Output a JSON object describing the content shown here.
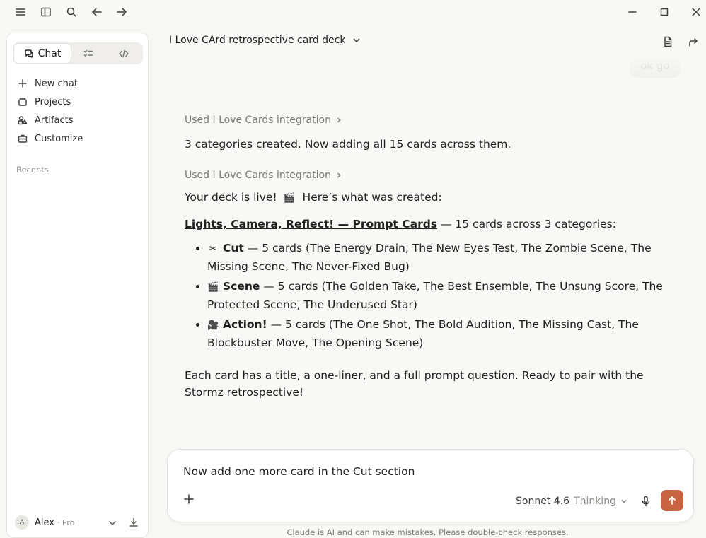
{
  "sidebar": {
    "modes": [
      {
        "label": "Chat",
        "icon": "chat-icon",
        "active": true
      },
      {
        "label": "",
        "icon": "tasks-icon",
        "active": false
      },
      {
        "label": "",
        "icon": "code-icon",
        "active": false
      }
    ],
    "nav": [
      {
        "label": "New chat",
        "icon": "plus-icon"
      },
      {
        "label": "Projects",
        "icon": "folder-icon"
      },
      {
        "label": "Artifacts",
        "icon": "artifacts-icon"
      },
      {
        "label": "Customize",
        "icon": "briefcase-icon"
      }
    ],
    "recents_label": "Recents",
    "user": {
      "initial": "A",
      "name": "Alex",
      "plan": "· Pro"
    }
  },
  "header": {
    "title": "I Love CArd retrospective card deck"
  },
  "conversation": {
    "user_message": "ok go",
    "tool_call_1": "Used I Love Cards integration",
    "text_1": "3 categories created. Now adding all 15 cards across them.",
    "tool_call_2": "Used I Love Cards integration",
    "text_2_prefix": "Your deck is live!",
    "text_2_emoji": "🎬",
    "text_2_suffix": "Here’s what was created:",
    "deck_title": "Lights, Camera, Reflect! — Prompt Cards",
    "deck_summary": "— 15 cards across 3 categories:",
    "categories": [
      {
        "emoji": "✂",
        "name": "Cut",
        "desc": "— 5 cards (The Energy Drain, The New Eyes Test, The Zombie Scene, The Missing Scene, The Never-Fixed Bug)"
      },
      {
        "emoji": "🎬",
        "name": "Scene",
        "desc": "— 5 cards (The Golden Take, The Best Ensemble, The Unsung Score, The Protected Scene, The Underused Star)"
      },
      {
        "emoji": "🎥",
        "name": "Action!",
        "desc": "— 5 cards (The One Shot, The Bold Audition, The Missing Cast, The Blockbuster Move, The Opening Scene)"
      }
    ],
    "closing": "Each card has a title, a one-liner, and a full prompt question. Ready to pair with the Stormz retrospective!"
  },
  "composer": {
    "text": "Now add one more card in the Cut section",
    "model": "Sonnet 4.6",
    "mode": "Thinking"
  },
  "disclaimer": "Claude is AI and can make mistakes. Please double-check responses.",
  "colors": {
    "accent": "#c96442",
    "background": "#f8f8f6",
    "sidebar": "#ffffff"
  }
}
